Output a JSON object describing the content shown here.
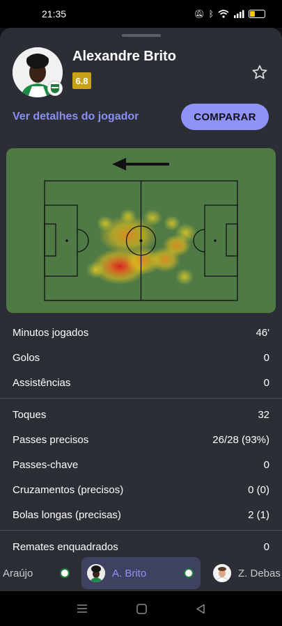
{
  "status_bar": {
    "time": "21:35",
    "icons": [
      "mute-icon",
      "bluetooth-icon",
      "wifi-icon",
      "signal-icon",
      "battery-icon"
    ],
    "battery_level": 0.35
  },
  "player": {
    "name": "Alexandre Brito",
    "rating": "6.8",
    "rating_color": "#c8a116",
    "details_link": "Ver detalhes do jogador",
    "compare_label": "COMPARAR",
    "accent_color": "#8f93f7"
  },
  "heatmap": {
    "attack_direction": "left",
    "pitch_color": "#4f7a46"
  },
  "stats": {
    "group1": [
      {
        "label": "Minutos jogados",
        "value": "46'"
      },
      {
        "label": "Golos",
        "value": "0"
      },
      {
        "label": "Assistências",
        "value": "0"
      }
    ],
    "group2": [
      {
        "label": "Toques",
        "value": "32"
      },
      {
        "label": "Passes precisos",
        "value": "26/28 (93%)"
      },
      {
        "label": "Passes-chave",
        "value": "0"
      },
      {
        "label": "Cruzamentos (precisos)",
        "value": "0 (0)"
      },
      {
        "label": "Bolas longas (precisas)",
        "value": "2 (1)"
      }
    ],
    "group3": [
      {
        "label": "Remates enquadrados",
        "value": "0"
      }
    ]
  },
  "player_tabs": [
    {
      "name": "Araújo"
    },
    {
      "name": "A. Brito"
    },
    {
      "name": "Z. Debas"
    }
  ]
}
